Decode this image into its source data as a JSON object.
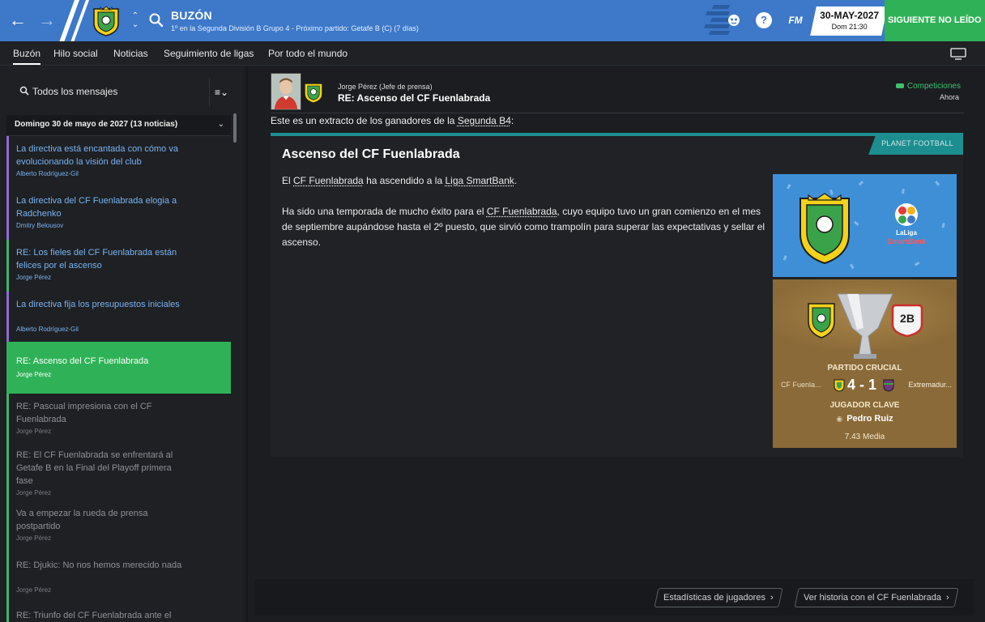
{
  "header": {
    "title": "BUZÓN",
    "subtitle": "1º en la Segunda División B Grupo 4 - Próximo partido: Getafe B (C)  (7 días)",
    "date": "30-MAY-2027",
    "time": "Dom 21:30",
    "next_button": "SIGUIENTE NO LEÍDO",
    "fm_label": "FM",
    "help_label": "?",
    "accent_color": "#3d78c9",
    "next_color": "#2fb257"
  },
  "tabs": [
    "Buzón",
    "Hilo social",
    "Noticias",
    "Seguimiento de ligas",
    "Por todo el mundo"
  ],
  "inbox": {
    "search_label": "Todos los mensajes",
    "filter_label": "≡⌄",
    "group_label": "Domingo 30 de mayo de 2027 (13 noticias)",
    "messages": [
      {
        "title": "La directiva está encantada con cómo va evolucionando la visión del club",
        "sender": "Alberto Rodríguez-Gil",
        "state": "unread",
        "bar": "#8e6ad6"
      },
      {
        "title": "La directiva del CF Fuenlabrada elogia a Radchenko",
        "sender": "Dmitry Belousov",
        "state": "unread",
        "bar": "#8e6ad6"
      },
      {
        "title": "RE: Los fieles del CF Fuenlabrada están felices por el ascenso",
        "sender": "Jorge Pérez",
        "state": "unread",
        "bar": "#3fb56a"
      },
      {
        "title": "La directiva fija los presupuestos iniciales",
        "sender": "Alberto Rodríguez-Gil",
        "state": "unread",
        "bar": "#8e6ad6"
      },
      {
        "title": "RE: Ascenso del CF Fuenlabrada",
        "sender": "Jorge Pérez",
        "state": "selected",
        "bar": "#2fb257"
      },
      {
        "title": "RE: Pascual impresiona con el CF Fuenlabrada",
        "sender": "Jorge Pérez",
        "state": "read",
        "bar": "#3fb56a"
      },
      {
        "title": "RE: El CF Fuenlabrada se enfrentará al Getafe B en la Final del Playoff primera fase",
        "sender": "Jorge Pérez",
        "state": "read",
        "bar": "#3fb56a"
      },
      {
        "title": "Va a empezar la rueda de prensa postpartido",
        "sender": "Jorge Pérez",
        "state": "read",
        "bar": "#3fb56a"
      },
      {
        "title": "RE: Djukic: No nos hemos merecido nada",
        "sender": "Jorge Pérez",
        "state": "read",
        "bar": "#3fb56a"
      },
      {
        "title": "RE: Triunfo del CF Fuenlabrada ante el",
        "sender": "",
        "state": "read",
        "bar": "#3fb56a"
      }
    ]
  },
  "message": {
    "sender": "Jorge Pérez  (Jefe de prensa)",
    "subject": "RE: Ascenso del CF Fuenlabrada",
    "tag": "Competiciones",
    "time": "Ahora",
    "intro_pre": "Este es un extracto de los ganadores de la ",
    "intro_link": "Segunda B4",
    "intro_post": ":",
    "source": "PLANET FOOTBALL",
    "headline": "Ascenso del CF Fuenlabrada",
    "p1_pre": "El ",
    "p1_club": "CF Fuenlabrada",
    "p1_mid": " ha ascendido a la ",
    "p1_league": "Liga SmartBank",
    "p1_post": ".",
    "p2_pre": "Ha sido una temporada de mucho éxito para el ",
    "p2_club": "CF Fuenlabrada",
    "p2_post": ", cuyo equipo tuvo un gran comienzo en el mes de septiembre aupándose hasta el 2º puesto, que sirvió como trampolín para superar las expectativas y sellar el ascenso."
  },
  "promo": {
    "laliga": "LaLiga",
    "smartbank": "SmartBank"
  },
  "match_card": {
    "label": "PARTIDO CRUCIAL",
    "home": "CF Fuenla...",
    "away": "Extremadur...",
    "score": "4 - 1",
    "key_label": "JUGADOR CLAVE",
    "player": "Pedro Ruiz",
    "rating": "7.43 Media",
    "badge": "2B"
  },
  "footer": {
    "stats_button": "Estadísticas de jugadores",
    "history_button": "Ver historia con el CF Fuenlabrada"
  }
}
